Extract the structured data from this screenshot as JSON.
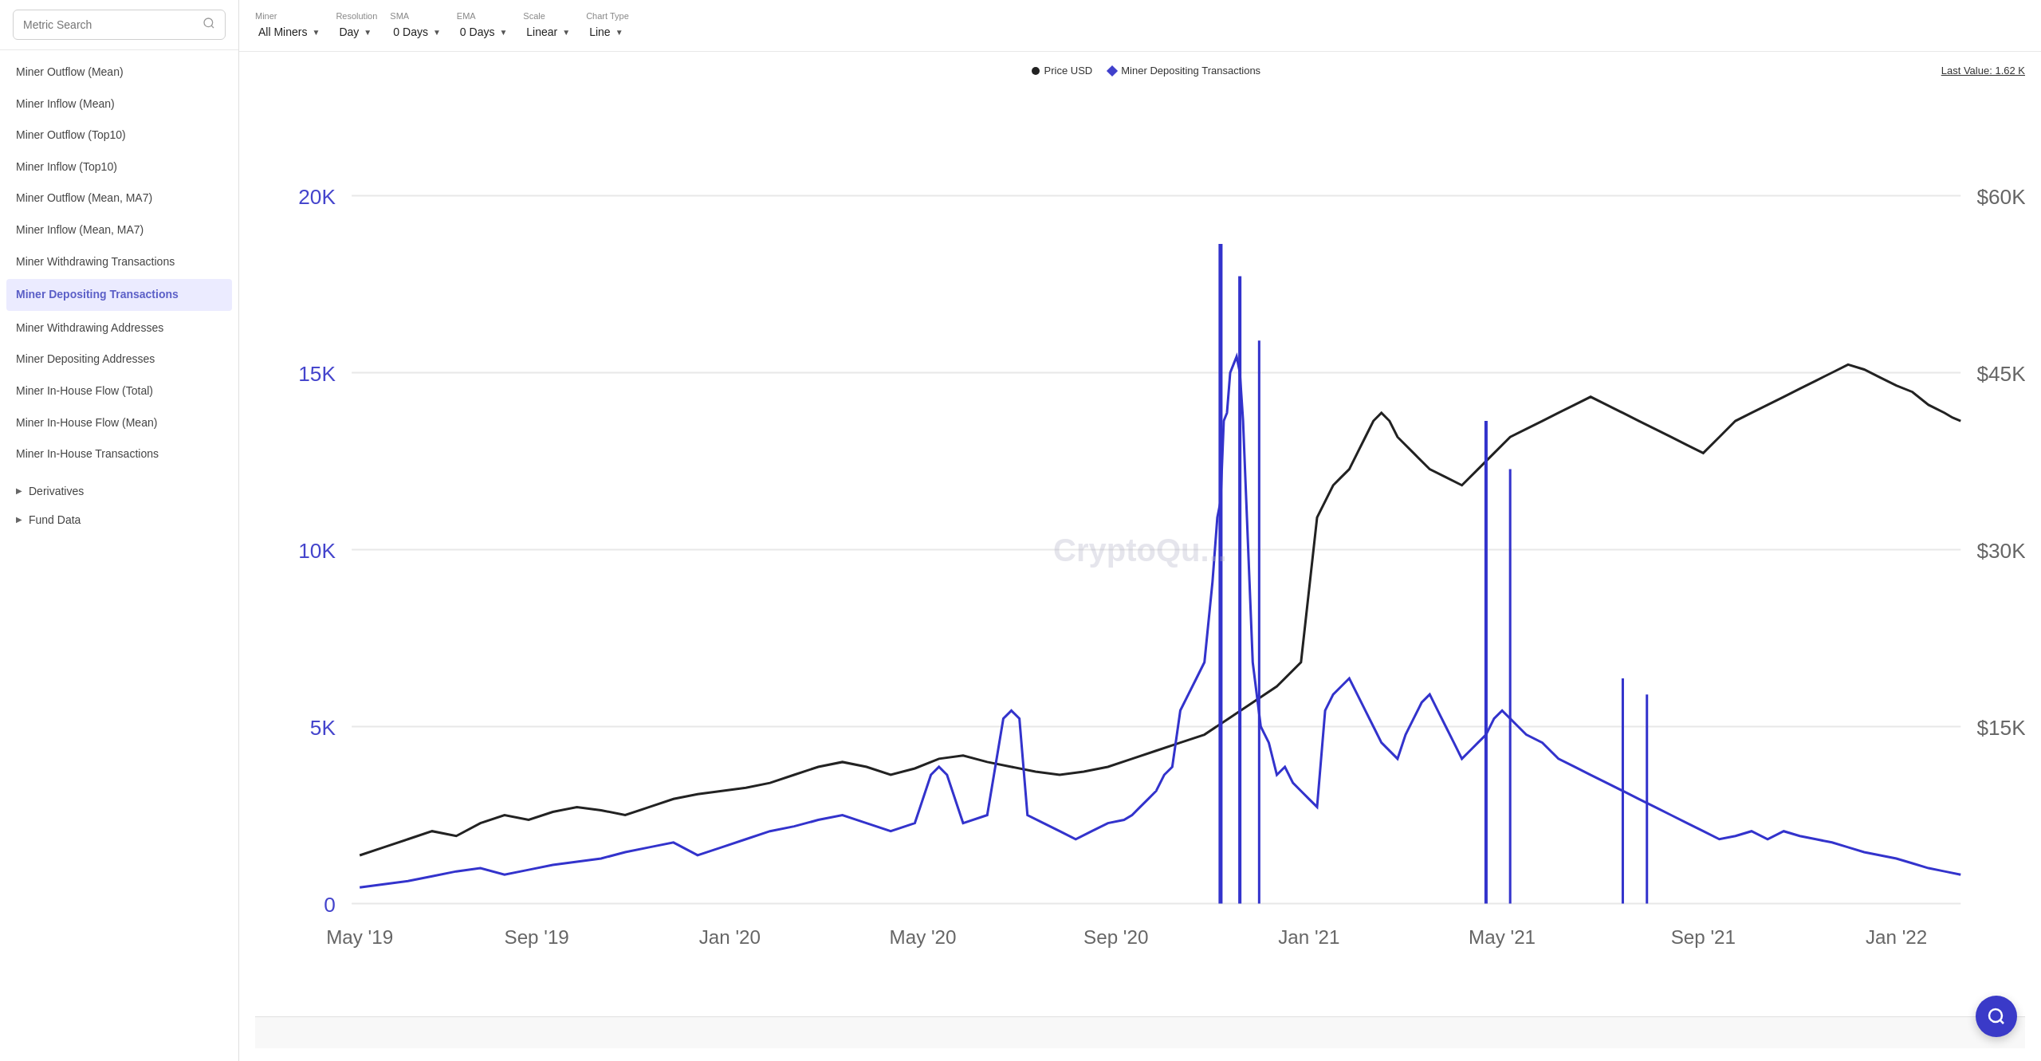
{
  "sidebar": {
    "search_placeholder": "Metric Search",
    "items": [
      {
        "label": "Miner Outflow (Mean)",
        "active": false
      },
      {
        "label": "Miner Inflow (Mean)",
        "active": false
      },
      {
        "label": "Miner Outflow (Top10)",
        "active": false
      },
      {
        "label": "Miner Inflow (Top10)",
        "active": false
      },
      {
        "label": "Miner Outflow (Mean, MA7)",
        "active": false
      },
      {
        "label": "Miner Inflow (Mean, MA7)",
        "active": false
      },
      {
        "label": "Miner Withdrawing Transactions",
        "active": false
      },
      {
        "label": "Miner Depositing Transactions",
        "active": true
      },
      {
        "label": "Miner Withdrawing Addresses",
        "active": false
      },
      {
        "label": "Miner Depositing Addresses",
        "active": false
      },
      {
        "label": "Miner In-House Flow (Total)",
        "active": false
      },
      {
        "label": "Miner In-House Flow (Mean)",
        "active": false
      },
      {
        "label": "Miner In-House Transactions",
        "active": false
      }
    ],
    "sections": [
      {
        "label": "Derivatives"
      },
      {
        "label": "Fund Data"
      }
    ]
  },
  "toolbar": {
    "miner_label": "Miner",
    "miner_value": "All Miners",
    "resolution_label": "Resolution",
    "resolution_value": "Day",
    "sma_label": "SMA",
    "sma_value": "0 Days",
    "ema_label": "EMA",
    "ema_value": "0 Days",
    "scale_label": "Scale",
    "scale_value": "Linear",
    "chart_type_label": "Chart Type",
    "chart_type_value": "Line"
  },
  "chart": {
    "title": "Miner Depositing Transactions",
    "legend_price": "Price USD",
    "legend_metric": "Miner Depositing Transactions",
    "last_value_label": "Last Value: 1.62 K",
    "watermark": "CryptoQu...",
    "y_axis_left": [
      "20K",
      "15K",
      "10K",
      "5K",
      "0"
    ],
    "y_axis_right": [
      "$60K",
      "$45K",
      "$30K",
      "$15K"
    ],
    "x_axis": [
      "May '19",
      "Sep '19",
      "Jan '20",
      "May '20",
      "Sep '20",
      "Jan '21",
      "May '21",
      "Sep '21",
      "Jan '22"
    ]
  }
}
